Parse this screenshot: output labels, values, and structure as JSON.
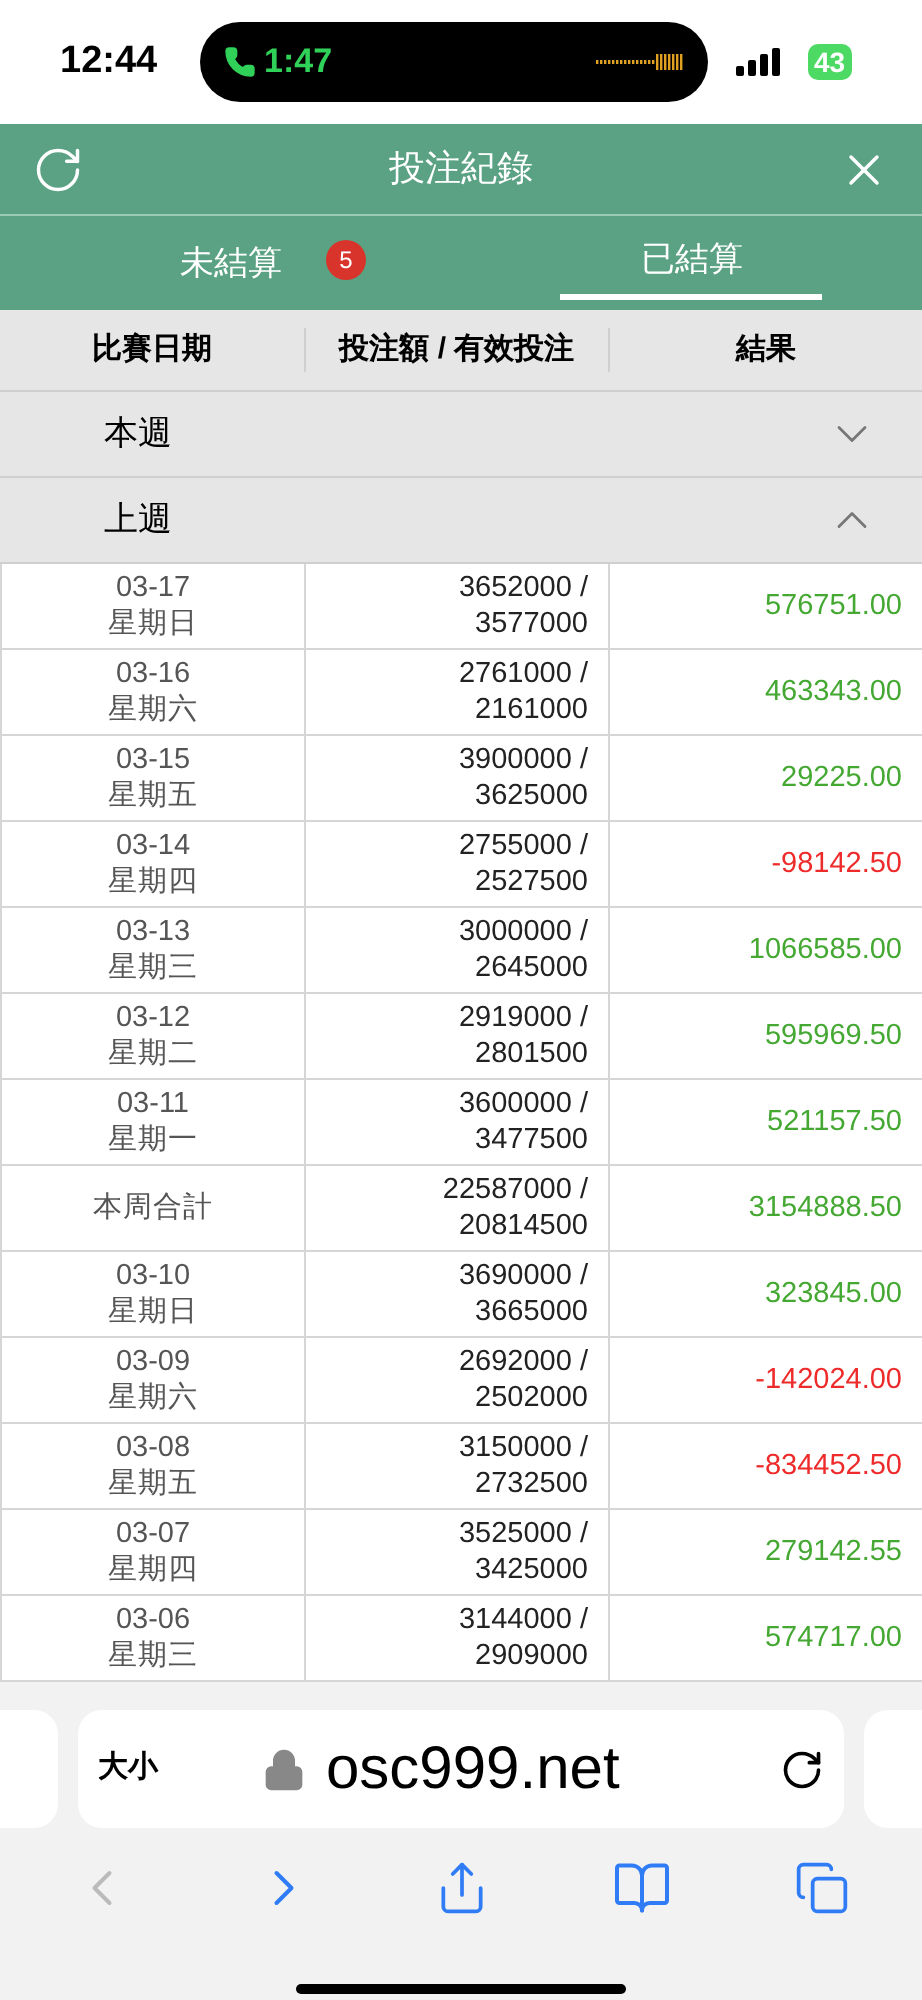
{
  "status_bar": {
    "time": "12:44",
    "call_time": "1:47",
    "battery": "43"
  },
  "header": {
    "title": "投注紀錄"
  },
  "tabs": [
    {
      "label": "未結算",
      "badge": "5",
      "selected": false
    },
    {
      "label": "已結算",
      "selected": true
    }
  ],
  "table": {
    "columns": [
      "比賽日期",
      "投注額 / 有效投注",
      "結果"
    ],
    "groups": [
      {
        "label": "本週",
        "expanded": false
      },
      {
        "label": "上週",
        "expanded": true,
        "rows": [
          {
            "kind": "day",
            "date": "03-17",
            "weekday": "星期日",
            "bet": "3652000 /",
            "valid": "3577000",
            "result": "576751.00",
            "color": "#44a832"
          },
          {
            "kind": "day",
            "date": "03-16",
            "weekday": "星期六",
            "bet": "2761000 /",
            "valid": "2161000",
            "result": "463343.00",
            "color": "#44a832"
          },
          {
            "kind": "day",
            "date": "03-15",
            "weekday": "星期五",
            "bet": "3900000 /",
            "valid": "3625000",
            "result": "29225.00",
            "color": "#44a832"
          },
          {
            "kind": "day",
            "date": "03-14",
            "weekday": "星期四",
            "bet": "2755000 /",
            "valid": "2527500",
            "result": "-98142.50",
            "color": "#ee2b2b"
          },
          {
            "kind": "day",
            "date": "03-13",
            "weekday": "星期三",
            "bet": "3000000 /",
            "valid": "2645000",
            "result": "1066585.00",
            "color": "#44a832"
          },
          {
            "kind": "day",
            "date": "03-12",
            "weekday": "星期二",
            "bet": "2919000 /",
            "valid": "2801500",
            "result": "595969.50",
            "color": "#44a832"
          },
          {
            "kind": "day",
            "date": "03-11",
            "weekday": "星期一",
            "bet": "3600000 /",
            "valid": "3477500",
            "result": "521157.50",
            "color": "#44a832"
          },
          {
            "kind": "total",
            "date": "本周合計",
            "bet": "22587000 /",
            "valid": "20814500",
            "result": "3154888.50",
            "color": "#44a832"
          },
          {
            "kind": "day",
            "date": "03-10",
            "weekday": "星期日",
            "bet": "3690000 /",
            "valid": "3665000",
            "result": "323845.00",
            "color": "#44a832"
          },
          {
            "kind": "day",
            "date": "03-09",
            "weekday": "星期六",
            "bet": "2692000 /",
            "valid": "2502000",
            "result": "-142024.00",
            "color": "#ee2b2b"
          },
          {
            "kind": "day",
            "date": "03-08",
            "weekday": "星期五",
            "bet": "3150000 /",
            "valid": "2732500",
            "result": "-834452.50",
            "color": "#ee2b2b"
          },
          {
            "kind": "day",
            "date": "03-07",
            "weekday": "星期四",
            "bet": "3525000 /",
            "valid": "3425000",
            "result": "279142.55",
            "color": "#44a832"
          },
          {
            "kind": "day",
            "date": "03-06",
            "weekday": "星期三",
            "bet": "3144000 /",
            "valid": "2909000",
            "result": "574717.00",
            "color": "#44a832"
          }
        ]
      }
    ]
  },
  "browser": {
    "text_size": "大小",
    "url": "osc999.net"
  }
}
